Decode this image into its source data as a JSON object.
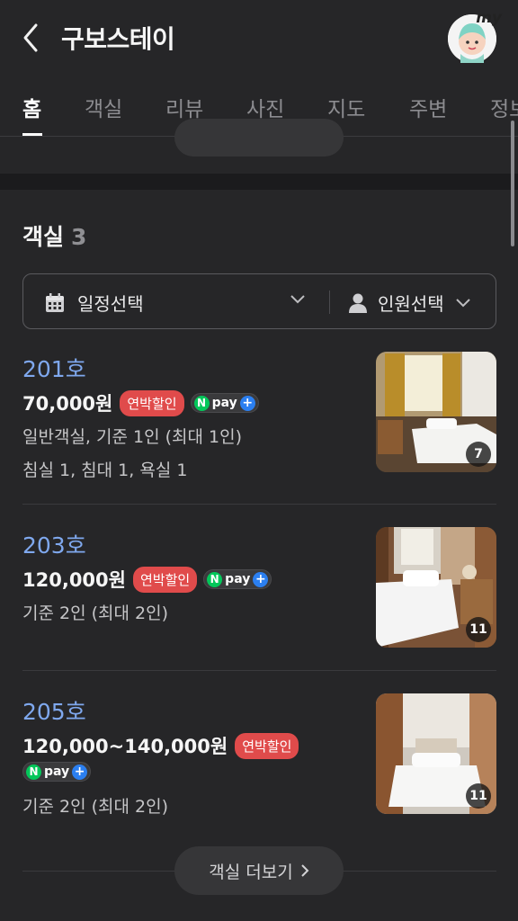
{
  "header": {
    "title": "구보스테이",
    "avatar_badge": "my"
  },
  "tabs": [
    {
      "label": "홈",
      "active": true
    },
    {
      "label": "객실"
    },
    {
      "label": "리뷰"
    },
    {
      "label": "사진"
    },
    {
      "label": "지도"
    },
    {
      "label": "주변"
    },
    {
      "label": "정보"
    }
  ],
  "rooms_section": {
    "title": "객실",
    "count": "3"
  },
  "filter": {
    "date_label": "일정선택",
    "people_label": "인원선택"
  },
  "rooms": [
    {
      "name": "201호",
      "price": "70,000원",
      "badge": "연박할인",
      "npay": "pay",
      "desc1": "일반객실, 기준 1인 (최대 1인)",
      "desc2": "침실 1, 침대 1, 욕실 1",
      "photo_count": "7"
    },
    {
      "name": "203호",
      "price": "120,000원",
      "badge": "연박할인",
      "npay": "pay",
      "desc1": "기준 2인 (최대 2인)",
      "photo_count": "11"
    },
    {
      "name": "205호",
      "price": "120,000~140,000원",
      "badge": "연박할인",
      "npay": "pay",
      "desc1": "기준 2인 (최대 2인)",
      "photo_count": "11"
    }
  ],
  "more_button": {
    "label": "객실 더보기"
  },
  "colors": {
    "background": "#262628",
    "room_name": "#7fa8ee",
    "sale_badge": "#e04b4b",
    "npay_green": "#03c75a",
    "npay_plus": "#2b7ff0"
  }
}
